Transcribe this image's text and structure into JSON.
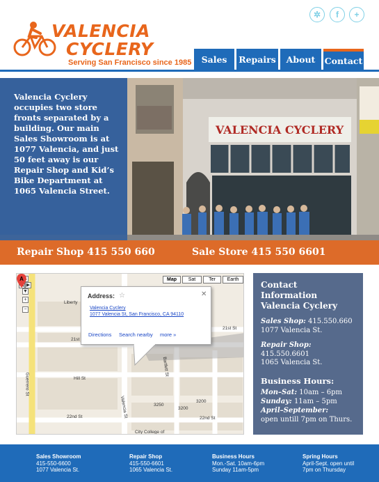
{
  "brand": {
    "name_line1": "VALENCIA",
    "name_line2": "CYCLERY",
    "tagline": "Serving San Francisco since 1985",
    "accent": "#e8661c",
    "primary": "#1f6bb9"
  },
  "social": [
    {
      "icon": "gear-icon",
      "glyph": "✲"
    },
    {
      "icon": "facebook-icon",
      "glyph": "f"
    },
    {
      "icon": "plus-icon",
      "glyph": "+"
    }
  ],
  "nav": {
    "sales": "Sales",
    "repairs": "Repairs",
    "about": "About",
    "contact": "Contact"
  },
  "hero": {
    "intro": "Valencia Cyclery occupies two store fronts separated by a building. Our main Sales Showroom is at 1077 Valencia, and just 50 feet away is our Repair Shop and Kid’s Bike Department at 1065 Valencia Street.",
    "storefront_sign": "VALENCIA CYCLERY",
    "repair_phone": "Repair Shop 415 550 660",
    "sale_phone": "Sale Store 415 550 6601"
  },
  "map": {
    "types": {
      "map": "Map",
      "satellite": "Sat",
      "terrain": "Ter",
      "earth": "Earth"
    },
    "popup": {
      "title": "Address:",
      "line1": "Valencia Cyclery",
      "line2": "1077 Valencia St, San Francisco, CA 94110",
      "directions": "Directions",
      "search_nearby": "Search nearby",
      "more": "more »"
    },
    "marker": "A",
    "streets": {
      "liberty": "Liberty",
      "st21_left": "21st",
      "st21_right": "21st St",
      "hill": "Hill St",
      "st22_left": "22nd St",
      "st22_right": "22nd St",
      "guerrero": "Guerrero St",
      "valencia": "Valencia St",
      "bartlett": "Bartlett St",
      "college": "City College of"
    },
    "numbers": {
      "n3200": "3200",
      "n3250": "3250",
      "n3200b": "3200",
      "n900": "900",
      "n3300": "3300"
    }
  },
  "contact": {
    "title": "Contact Information Valencia Cyclery",
    "sales_label": "Sales Shop:",
    "sales_phone": "415.550.660",
    "sales_address": "1077 Valencia St.",
    "repair_label": "Repair Shop:",
    "repair_phone": "415.550.6601",
    "repair_address": "1065 Valencia St.",
    "hours_title": "Business Hours:",
    "hours1_label": "Mon–Sat:",
    "hours1_value": "10am – 6pm",
    "hours2_label": "Sunday:",
    "hours2_value": "11am – 5pm",
    "hours3_label": "April–September:",
    "hours3_value": "open untill 7pm on Thurs."
  },
  "footer": [
    {
      "title": "Sales Showroom",
      "line1": "415-550-6600",
      "line2": "1077 Valencia St."
    },
    {
      "title": "Repair Shop",
      "line1": "415-550-6601",
      "line2": "1065 Valencia St."
    },
    {
      "title": "Business Hours",
      "line1": "Mon.-Sat. 10am-6pm",
      "line2": "Sunday 11am-5pm"
    },
    {
      "title": "Spring Hours",
      "line1": "April-Sept. open until",
      "line2": "7pm on Thursday"
    }
  ]
}
